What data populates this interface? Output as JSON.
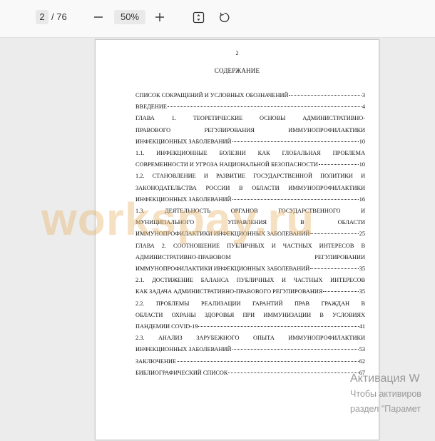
{
  "toolbar": {
    "current_page": "2",
    "total_pages": "/ 76",
    "zoom_level": "50%",
    "icons": [
      "minus-icon",
      "plus-icon",
      "fit-page-icon",
      "rotate-icon"
    ]
  },
  "document": {
    "page_number": "2",
    "title": "СОДЕРЖАНИЕ",
    "toc": [
      {
        "lines": [],
        "last": "СПИСОК СОКРАЩЕНИЙ И УСЛОВНЫХ ОБОЗНАЧЕНИЙ",
        "page": "3"
      },
      {
        "lines": [],
        "last": "ВВЕДЕНИЕ",
        "page": "4"
      },
      {
        "lines": [
          "ГЛАВА 1. ТЕОРЕТИЧЕСКИЕ ОСНОВЫ АДМИНИСТРАТИВНО-",
          "ПРАВОВОГО РЕГУЛИРОВАНИЯ ИММУНОПРОФИЛАКТИКИ"
        ],
        "last": "ИНФЕКЦИОННЫХ ЗАБОЛЕВАНИЙ",
        "page": "10"
      },
      {
        "lines": [
          "1.1. ИНФЕКЦИОННЫЕ БОЛЕЗНИ КАК ГЛОБАЛЬНАЯ ПРОБЛЕМА"
        ],
        "last": "СОВРЕМЕННОСТИ И УГРОЗА НАЦИОНАЛЬНОЙ БЕЗОПАСНОСТИ",
        "page": "10"
      },
      {
        "lines": [
          "1.2. СТАНОВЛЕНИЕ И РАЗВИТИЕ ГОСУДАРСТВЕННОЙ ПОЛИТИКИ И",
          "ЗАКОНОДАТЕЛЬСТВА РОССИИ В ОБЛАСТИ ИММУНОПРОФИЛАКТИКИ"
        ],
        "last": "ИНФЕКЦИОННЫХ ЗАБОЛЕВАНИЙ",
        "page": "16"
      },
      {
        "lines": [
          "1.3. ДЕЯТЕЛЬНОСТЬ ОРГАНОВ ГОСУДАРСТВЕННОГО И",
          "МУНИЦИПАЛЬНОГО УПРАВЛЕНИЯ В ОБЛАСТИ"
        ],
        "last": "ИММУНОПРОФИЛАКТИКИ ИНФЕКЦИОННЫХ ЗАБОЛЕВАНИЙ",
        "page": "25"
      },
      {
        "lines": [
          "ГЛАВА 2. СООТНОШЕНИЕ ПУБЛИЧНЫХ И ЧАСТНЫХ ИНТЕРЕСОВ В",
          "АДМИНИСТРАТИВНО-ПРАВОВОМ РЕГУЛИРОВАНИИ"
        ],
        "last": "ИММУНОПРОФИЛАКТИКИ ИНФЕКЦИОННЫХ ЗАБОЛЕВАНИЙ",
        "page": "35"
      },
      {
        "lines": [
          "2.1. ДОСТИЖЕНИЕ БАЛАНСА ПУБЛИЧНЫХ И ЧАСТНЫХ ИНТЕРЕСОВ"
        ],
        "last": "КАК ЗАДАЧА АДМИНИСТРАТИВНО-ПРАВОВОГО РЕГУЛИРОВАНИЯ",
        "page": "35"
      },
      {
        "lines": [
          "2.2. ПРОБЛЕМЫ РЕАЛИЗАЦИИ ГАРАНТИЙ ПРАВ ГРАЖДАН В",
          "ОБЛАСТИ ОХРАНЫ ЗДОРОВЬЯ ПРИ ИММУНИЗАЦИИ В УСЛОВИЯХ"
        ],
        "last": "ПАНДЕМИИ COVID-19",
        "page": "41"
      },
      {
        "lines": [
          "2.3. АНАЛИЗ ЗАРУБЕЖНОГО ОПЫТА ИММУНОПРОФИЛАКТИКИ"
        ],
        "last": "ИНФЕКЦИОННЫХ ЗАБОЛЕВАНИЙ",
        "page": "53"
      },
      {
        "lines": [],
        "last": "ЗАКЛЮЧЕНИЕ",
        "page": "62"
      },
      {
        "lines": [],
        "last": "БИБЛИОГРАФИЧЕСКИЙ СПИСОК",
        "page": "67"
      }
    ]
  },
  "watermark": "workspay.ru",
  "activation": {
    "title": "Активация W",
    "line1": "Чтобы активиров",
    "line2": "раздел \"Парамет"
  }
}
